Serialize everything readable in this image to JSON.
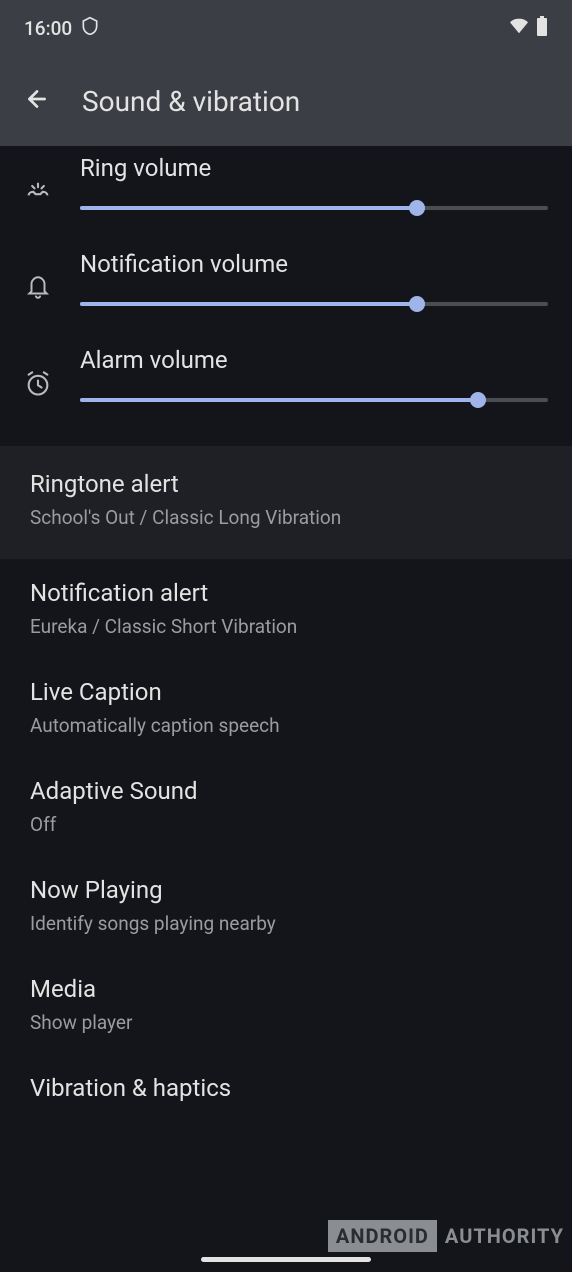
{
  "status": {
    "time": "16:00"
  },
  "header": {
    "title": "Sound & vibration"
  },
  "sliders": [
    {
      "label": "Ring volume",
      "value": 72
    },
    {
      "label": "Notification volume",
      "value": 72
    },
    {
      "label": "Alarm volume",
      "value": 85
    }
  ],
  "items": [
    {
      "title": "Ringtone alert",
      "subtitle": "School's Out / Classic Long Vibration",
      "highlighted": true
    },
    {
      "title": "Notification alert",
      "subtitle": "Eureka / Classic Short Vibration"
    },
    {
      "title": "Live Caption",
      "subtitle": "Automatically caption speech"
    },
    {
      "title": "Adaptive Sound",
      "subtitle": "Off"
    },
    {
      "title": "Now Playing",
      "subtitle": "Identify songs playing nearby"
    },
    {
      "title": "Media",
      "subtitle": "Show player"
    },
    {
      "title": "Vibration & haptics",
      "subtitle": ""
    }
  ],
  "watermark": {
    "box": "ANDROID",
    "text": "AUTHORITY"
  }
}
